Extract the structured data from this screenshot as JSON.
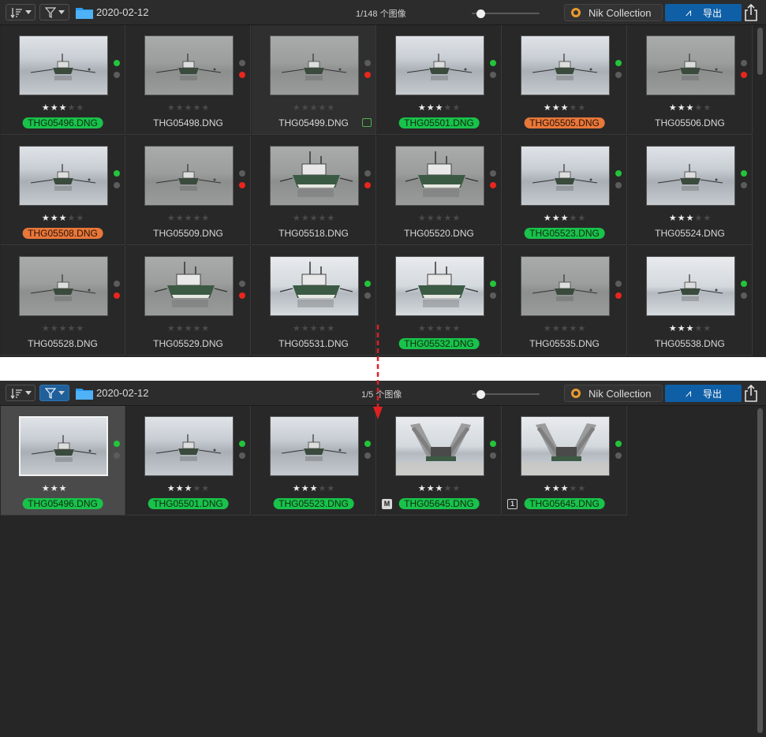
{
  "top": {
    "folder": "2020-02-12",
    "count": "1/148 个图像",
    "nik_label": "Nik Collection",
    "export_label": "导出",
    "cells": [
      {
        "name": "THG05496.DNG",
        "rating": 3,
        "label": "green",
        "dot1": "green",
        "dot2": "gray",
        "photo": "light",
        "boat": "small"
      },
      {
        "name": "THG05498.DNG",
        "rating": 0,
        "label": "none",
        "dot1": "gray",
        "dot2": "red",
        "photo": "gray",
        "boat": "small"
      },
      {
        "name": "THG05499.DNG",
        "rating": 0,
        "label": "none",
        "dot1": "gray",
        "dot2": "red",
        "photo": "gray",
        "boat": "small",
        "import": true
      },
      {
        "name": "THG05501.DNG",
        "rating": 3,
        "label": "green",
        "dot1": "green",
        "dot2": "gray",
        "photo": "light",
        "boat": "small"
      },
      {
        "name": "THG05505.DNG",
        "rating": 3,
        "label": "orange",
        "dot1": "green",
        "dot2": "gray",
        "photo": "light",
        "boat": "small"
      },
      {
        "name": "THG05506.DNG",
        "rating": 3,
        "label": "none",
        "dot1": "gray",
        "dot2": "red",
        "photo": "gray",
        "boat": "small"
      },
      {
        "name": "THG05508.DNG",
        "rating": 3,
        "label": "orange",
        "dot1": "green",
        "dot2": "gray",
        "photo": "light",
        "boat": "small"
      },
      {
        "name": "THG05509.DNG",
        "rating": 0,
        "label": "none",
        "dot1": "gray",
        "dot2": "red",
        "photo": "gray",
        "boat": "small"
      },
      {
        "name": "THG05518.DNG",
        "rating": 0,
        "label": "none",
        "dot1": "gray",
        "dot2": "red",
        "photo": "gray",
        "boat": "large"
      },
      {
        "name": "THG05520.DNG",
        "rating": 0,
        "label": "none",
        "dot1": "gray",
        "dot2": "red",
        "photo": "gray",
        "boat": "large"
      },
      {
        "name": "THG05523.DNG",
        "rating": 3,
        "label": "green",
        "dot1": "green",
        "dot2": "gray",
        "photo": "light",
        "boat": "small"
      },
      {
        "name": "THG05524.DNG",
        "rating": 3,
        "label": "none",
        "dot1": "green",
        "dot2": "gray",
        "photo": "light",
        "boat": "small"
      },
      {
        "name": "THG05528.DNG",
        "rating": 0,
        "label": "none",
        "dot1": "gray",
        "dot2": "red",
        "photo": "gray",
        "boat": "small"
      },
      {
        "name": "THG05529.DNG",
        "rating": 0,
        "label": "none",
        "dot1": "gray",
        "dot2": "red",
        "photo": "gray",
        "boat": "large"
      },
      {
        "name": "THG05531.DNG",
        "rating": 0,
        "label": "none",
        "dot1": "green",
        "dot2": "gray",
        "photo": "bright",
        "boat": "large"
      },
      {
        "name": "THG05532.DNG",
        "rating": 0,
        "label": "green",
        "dot1": "green",
        "dot2": "gray",
        "photo": "bright",
        "boat": "large"
      },
      {
        "name": "THG05535.DNG",
        "rating": 0,
        "label": "none",
        "dot1": "gray",
        "dot2": "red",
        "photo": "gray",
        "boat": "small"
      },
      {
        "name": "THG05538.DNG",
        "rating": 3,
        "label": "none",
        "dot1": "green",
        "dot2": "gray",
        "photo": "bright",
        "boat": "small"
      }
    ]
  },
  "bottom": {
    "folder": "2020-02-12",
    "count": "1/5 个图像",
    "nik_label": "Nik Collection",
    "export_label": "导出",
    "cells": [
      {
        "name": "THG05496.DNG",
        "rating": 3,
        "label": "green",
        "dot1": "green",
        "dot2": "gray",
        "photo": "light",
        "boat": "small",
        "selected": true
      },
      {
        "name": "THG05501.DNG",
        "rating": 3,
        "label": "green",
        "dot1": "green",
        "dot2": "gray",
        "photo": "light",
        "boat": "small"
      },
      {
        "name": "THG05523.DNG",
        "rating": 3,
        "label": "green",
        "dot1": "green",
        "dot2": "gray",
        "photo": "light",
        "boat": "small"
      },
      {
        "name": "THG05645.DNG",
        "rating": 3,
        "label": "green",
        "dot1": "green",
        "dot2": "gray",
        "photo": "bright",
        "boat": "nets",
        "badge": "M"
      },
      {
        "name": "THG05645.DNG",
        "rating": 3,
        "label": "green",
        "dot1": "green",
        "dot2": "gray",
        "photo": "bright",
        "boat": "nets",
        "badge": "1"
      }
    ]
  },
  "colors": {
    "accent": "#0f5fa6",
    "green_label": "#19c24a",
    "orange_label": "#e8773a",
    "red_dot": "#e8261e",
    "green_dot": "#23c43a"
  },
  "icons": [
    "sort-icon",
    "filter-icon",
    "folder-icon",
    "nik-collection-icon",
    "export-icon",
    "share-icon",
    "import-icon",
    "arrow-down-icon"
  ]
}
